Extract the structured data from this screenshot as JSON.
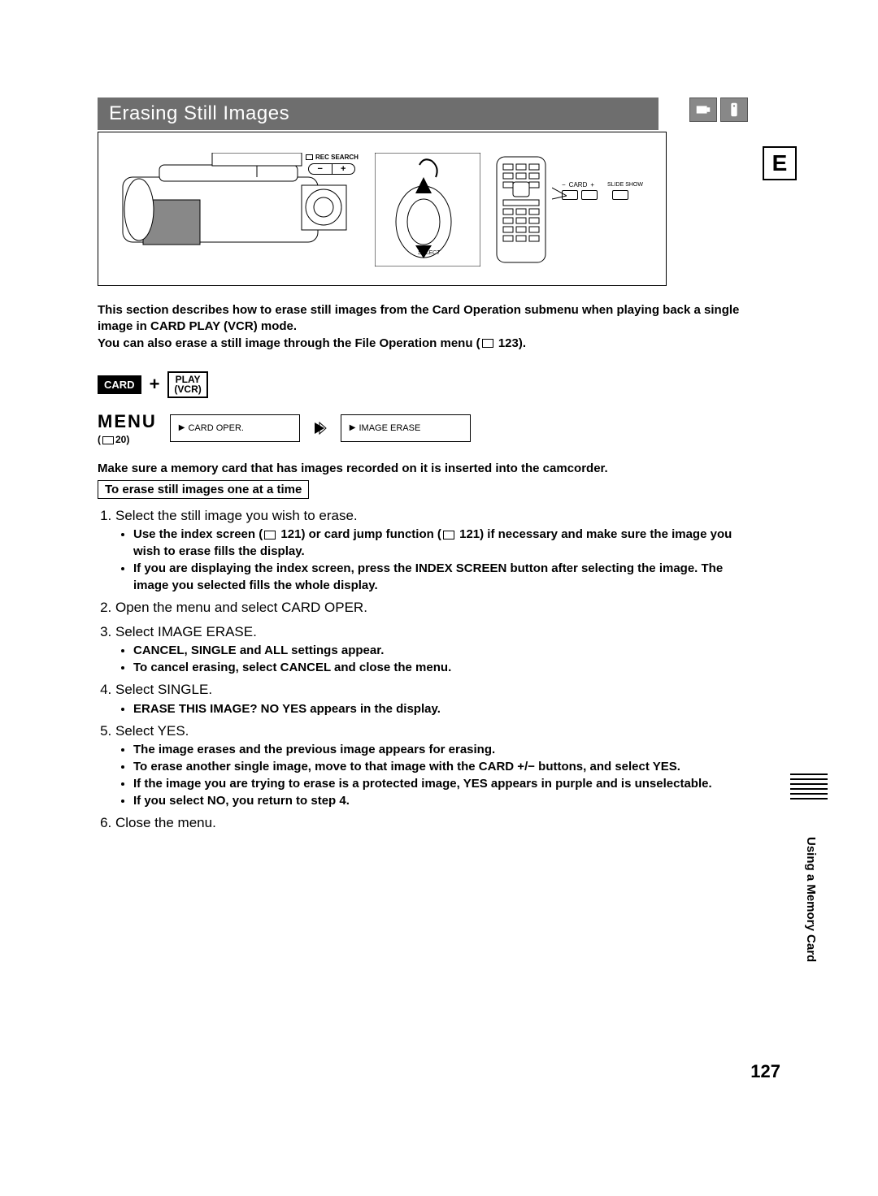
{
  "title": "Erasing Still Images",
  "e_label": "E",
  "illus": {
    "rec_search": "REC SEARCH",
    "select_label": "SELECT",
    "card_label": "CARD",
    "slide_show": "SLIDE\nSHOW",
    "minus": "−",
    "plus": "+"
  },
  "intro_line1": "This section describes how to erase still images from the Card Operation submenu when playing back a single image in CARD PLAY (VCR) mode.",
  "intro_line2_a": "You can also erase a still image through the File Operation menu (",
  "intro_line2_page": "123",
  "intro_line2_b": ").",
  "mode": {
    "card": "CARD",
    "plus": "+",
    "play": "PLAY",
    "vcr": "(VCR)"
  },
  "menu": {
    "word": "MENU",
    "ref_open": "(",
    "ref_page": "20",
    "ref_close": ")",
    "box1": "CARD OPER.",
    "box2": "IMAGE ERASE"
  },
  "note_card_inserted": "Make sure a memory card that has images recorded on it is inserted into the camcorder.",
  "subhead": "To erase still images one at a time",
  "steps": {
    "s1": "Select the still image you wish to erase.",
    "s1b1a": "Use the index screen (",
    "s1b1page1": "121",
    "s1b1b": ") or card jump function (",
    "s1b1page2": "121",
    "s1b1c": ") if necessary and make sure the image you wish to erase fills the display.",
    "s1b2": "If you are displaying the index screen, press the INDEX SCREEN button after selecting the image. The image you selected fills the whole display.",
    "s2": "Open the menu and select CARD OPER.",
    "s3": "Select IMAGE ERASE.",
    "s3b1": "CANCEL, SINGLE and ALL settings appear.",
    "s3b2": "To cancel erasing, select CANCEL and close the menu.",
    "s4": "Select SINGLE.",
    "s4b1": "ERASE THIS IMAGE? NO YES appears in the display.",
    "s5": "Select YES.",
    "s5b1": "The image erases and the previous image appears for erasing.",
    "s5b2": "To erase another single image, move to that image with the CARD +/− buttons, and select YES.",
    "s5b3": "If the image you are trying to erase is a protected image, YES appears in purple and is unselectable.",
    "s5b4": "If you select NO, you return to step 4.",
    "s6": "Close the menu."
  },
  "side_label": "Using a Memory Card",
  "page_number": "127"
}
